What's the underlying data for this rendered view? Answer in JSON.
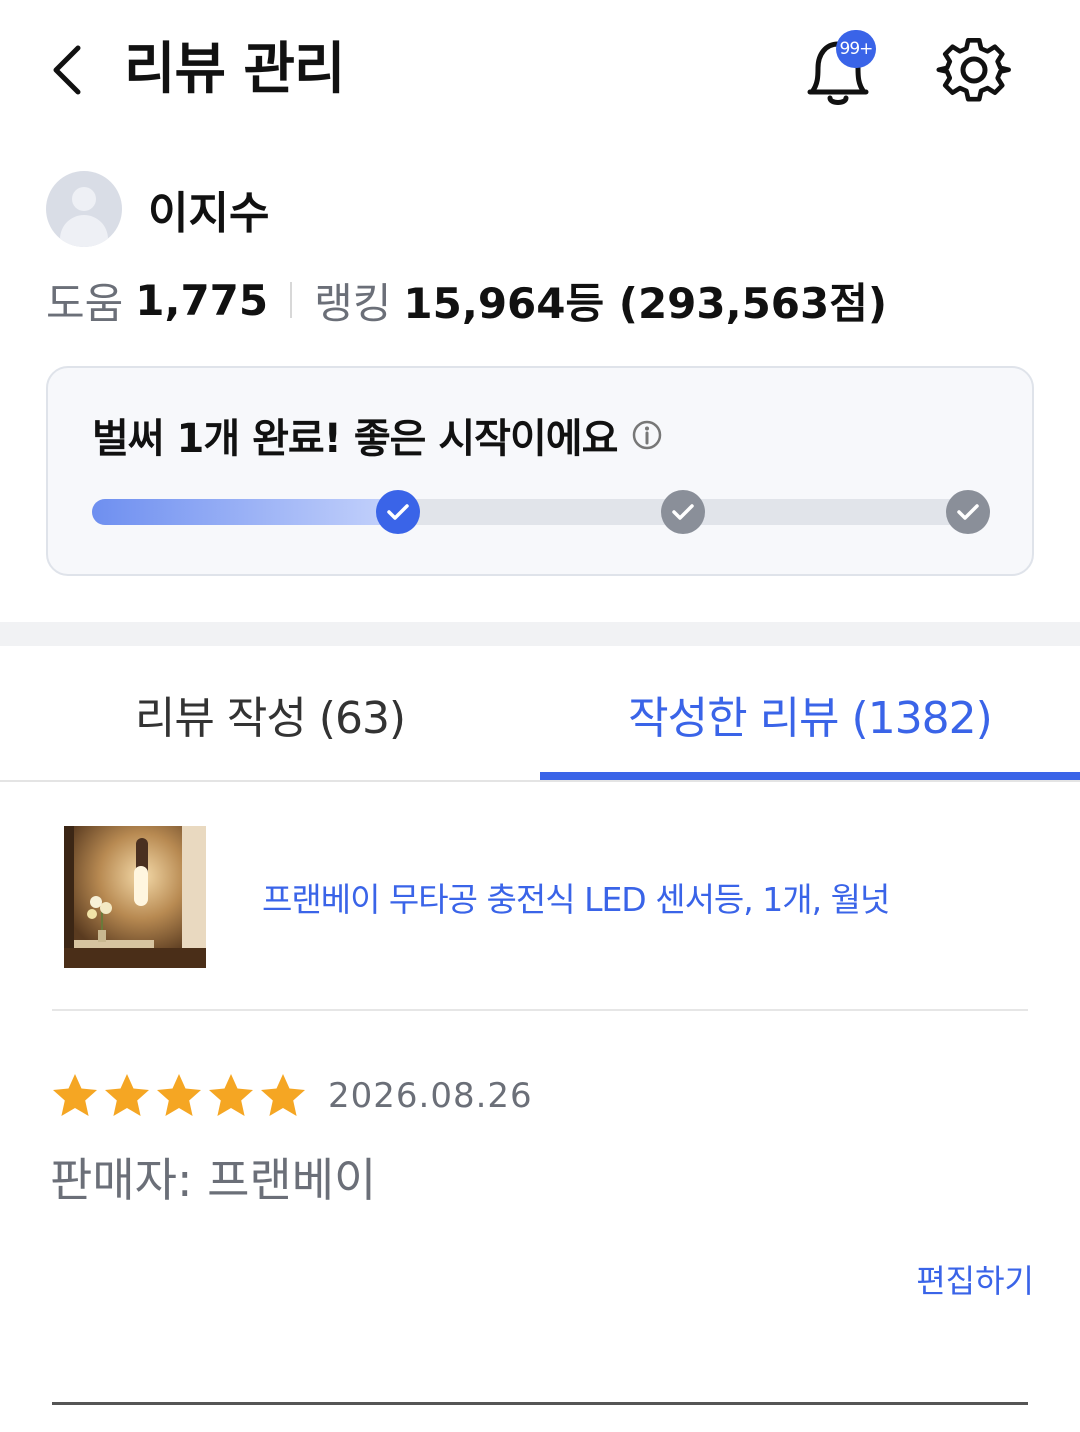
{
  "header": {
    "title": "리뷰 관리",
    "back_icon": "chevron-left-icon",
    "notification_badge": "99+",
    "bell_icon": "bell-icon",
    "settings_icon": "gear-icon"
  },
  "profile": {
    "name": "이지수",
    "avatar_icon": "default-avatar-icon"
  },
  "stats": {
    "help_label": "도움",
    "help_value": "1,775",
    "ranking_label": "랭킹",
    "ranking_value": "15,964등 (293,563점)"
  },
  "progress": {
    "title": "벌써 1개 완료! 좋은 시작이에요",
    "info_icon": "info-icon",
    "completed_fraction": 0.333,
    "steps": [
      {
        "state": "done"
      },
      {
        "state": "todo"
      },
      {
        "state": "todo"
      }
    ]
  },
  "tabs": [
    {
      "label": "리뷰 작성 (63)",
      "active": false
    },
    {
      "label": "작성한 리뷰 (1382)",
      "active": true
    }
  ],
  "review": {
    "product_name": "프랜베이 무타공 충전식 LED 센서등, 1개, 월넛",
    "rating": 5,
    "rating_max": 5,
    "date": "2026.08.26",
    "seller": "판매자: 프랜베이",
    "edit_label": "편집하기"
  },
  "colors": {
    "accent": "#3a64e8",
    "star": "#f5a623",
    "muted_text": "#6b6f78",
    "step_inactive": "#8a8f99"
  }
}
